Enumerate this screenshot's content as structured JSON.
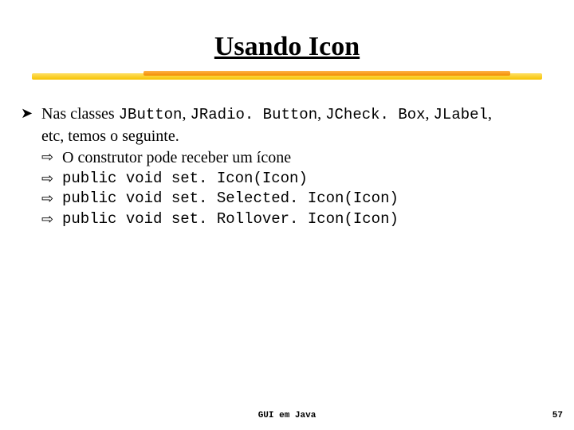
{
  "title": "Usando Icon",
  "bullet_main": "➤",
  "bullet_sub": "⇨",
  "line1_a": "Nas classes ",
  "line1_b": "JButton",
  "line1_c": ", ",
  "line1_d": "JRadio. Button",
  "line1_e": ", ",
  "line1_f": "JCheck. Box",
  "line1_g": ", ",
  "line1_h": "JLabel",
  "line1_i": ", ",
  "line2": "etc, temos o seguinte.",
  "sub1": "O construtor pode receber um ícone",
  "sub2": "public void set. Icon(Icon)",
  "sub3": "public void set. Selected. Icon(Icon)",
  "sub4": "public void set. Rollover. Icon(Icon)",
  "footer_center": "GUI em Java",
  "footer_right": "57"
}
